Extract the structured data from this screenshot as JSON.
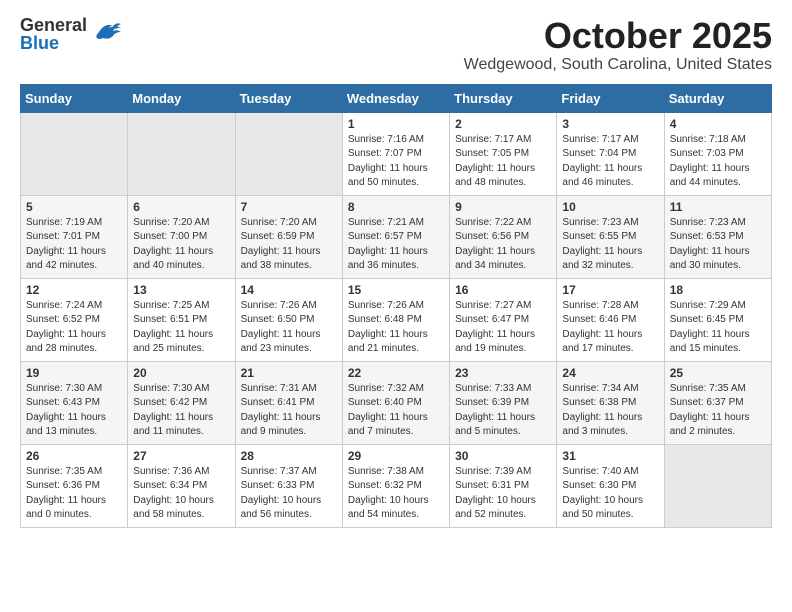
{
  "header": {
    "logo": {
      "general": "General",
      "blue": "Blue"
    },
    "title": "October 2025",
    "subtitle": "Wedgewood, South Carolina, United States"
  },
  "weekdays": [
    "Sunday",
    "Monday",
    "Tuesday",
    "Wednesday",
    "Thursday",
    "Friday",
    "Saturday"
  ],
  "weeks": [
    [
      {
        "day": "",
        "info": ""
      },
      {
        "day": "",
        "info": ""
      },
      {
        "day": "",
        "info": ""
      },
      {
        "day": "1",
        "info": "Sunrise: 7:16 AM\nSunset: 7:07 PM\nDaylight: 11 hours\nand 50 minutes."
      },
      {
        "day": "2",
        "info": "Sunrise: 7:17 AM\nSunset: 7:05 PM\nDaylight: 11 hours\nand 48 minutes."
      },
      {
        "day": "3",
        "info": "Sunrise: 7:17 AM\nSunset: 7:04 PM\nDaylight: 11 hours\nand 46 minutes."
      },
      {
        "day": "4",
        "info": "Sunrise: 7:18 AM\nSunset: 7:03 PM\nDaylight: 11 hours\nand 44 minutes."
      }
    ],
    [
      {
        "day": "5",
        "info": "Sunrise: 7:19 AM\nSunset: 7:01 PM\nDaylight: 11 hours\nand 42 minutes."
      },
      {
        "day": "6",
        "info": "Sunrise: 7:20 AM\nSunset: 7:00 PM\nDaylight: 11 hours\nand 40 minutes."
      },
      {
        "day": "7",
        "info": "Sunrise: 7:20 AM\nSunset: 6:59 PM\nDaylight: 11 hours\nand 38 minutes."
      },
      {
        "day": "8",
        "info": "Sunrise: 7:21 AM\nSunset: 6:57 PM\nDaylight: 11 hours\nand 36 minutes."
      },
      {
        "day": "9",
        "info": "Sunrise: 7:22 AM\nSunset: 6:56 PM\nDaylight: 11 hours\nand 34 minutes."
      },
      {
        "day": "10",
        "info": "Sunrise: 7:23 AM\nSunset: 6:55 PM\nDaylight: 11 hours\nand 32 minutes."
      },
      {
        "day": "11",
        "info": "Sunrise: 7:23 AM\nSunset: 6:53 PM\nDaylight: 11 hours\nand 30 minutes."
      }
    ],
    [
      {
        "day": "12",
        "info": "Sunrise: 7:24 AM\nSunset: 6:52 PM\nDaylight: 11 hours\nand 28 minutes."
      },
      {
        "day": "13",
        "info": "Sunrise: 7:25 AM\nSunset: 6:51 PM\nDaylight: 11 hours\nand 25 minutes."
      },
      {
        "day": "14",
        "info": "Sunrise: 7:26 AM\nSunset: 6:50 PM\nDaylight: 11 hours\nand 23 minutes."
      },
      {
        "day": "15",
        "info": "Sunrise: 7:26 AM\nSunset: 6:48 PM\nDaylight: 11 hours\nand 21 minutes."
      },
      {
        "day": "16",
        "info": "Sunrise: 7:27 AM\nSunset: 6:47 PM\nDaylight: 11 hours\nand 19 minutes."
      },
      {
        "day": "17",
        "info": "Sunrise: 7:28 AM\nSunset: 6:46 PM\nDaylight: 11 hours\nand 17 minutes."
      },
      {
        "day": "18",
        "info": "Sunrise: 7:29 AM\nSunset: 6:45 PM\nDaylight: 11 hours\nand 15 minutes."
      }
    ],
    [
      {
        "day": "19",
        "info": "Sunrise: 7:30 AM\nSunset: 6:43 PM\nDaylight: 11 hours\nand 13 minutes."
      },
      {
        "day": "20",
        "info": "Sunrise: 7:30 AM\nSunset: 6:42 PM\nDaylight: 11 hours\nand 11 minutes."
      },
      {
        "day": "21",
        "info": "Sunrise: 7:31 AM\nSunset: 6:41 PM\nDaylight: 11 hours\nand 9 minutes."
      },
      {
        "day": "22",
        "info": "Sunrise: 7:32 AM\nSunset: 6:40 PM\nDaylight: 11 hours\nand 7 minutes."
      },
      {
        "day": "23",
        "info": "Sunrise: 7:33 AM\nSunset: 6:39 PM\nDaylight: 11 hours\nand 5 minutes."
      },
      {
        "day": "24",
        "info": "Sunrise: 7:34 AM\nSunset: 6:38 PM\nDaylight: 11 hours\nand 3 minutes."
      },
      {
        "day": "25",
        "info": "Sunrise: 7:35 AM\nSunset: 6:37 PM\nDaylight: 11 hours\nand 2 minutes."
      }
    ],
    [
      {
        "day": "26",
        "info": "Sunrise: 7:35 AM\nSunset: 6:36 PM\nDaylight: 11 hours\nand 0 minutes."
      },
      {
        "day": "27",
        "info": "Sunrise: 7:36 AM\nSunset: 6:34 PM\nDaylight: 10 hours\nand 58 minutes."
      },
      {
        "day": "28",
        "info": "Sunrise: 7:37 AM\nSunset: 6:33 PM\nDaylight: 10 hours\nand 56 minutes."
      },
      {
        "day": "29",
        "info": "Sunrise: 7:38 AM\nSunset: 6:32 PM\nDaylight: 10 hours\nand 54 minutes."
      },
      {
        "day": "30",
        "info": "Sunrise: 7:39 AM\nSunset: 6:31 PM\nDaylight: 10 hours\nand 52 minutes."
      },
      {
        "day": "31",
        "info": "Sunrise: 7:40 AM\nSunset: 6:30 PM\nDaylight: 10 hours\nand 50 minutes."
      },
      {
        "day": "",
        "info": ""
      }
    ]
  ]
}
